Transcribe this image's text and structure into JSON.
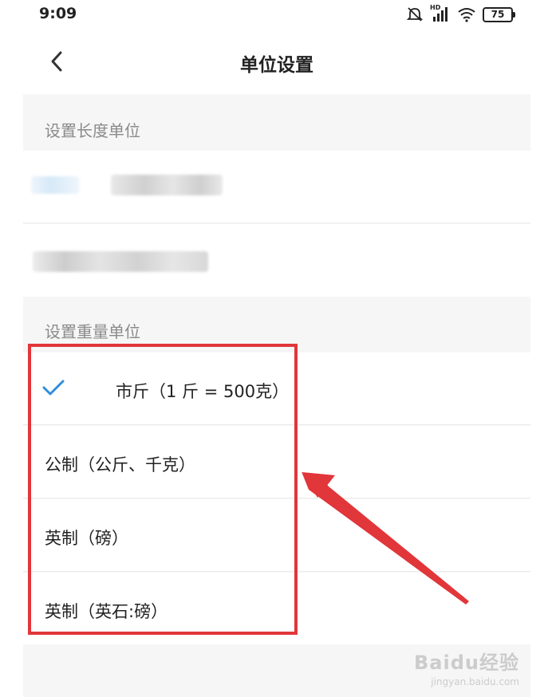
{
  "status_bar": {
    "time": "9:09",
    "network_label": "HD",
    "battery": "75"
  },
  "header": {
    "title": "单位设置"
  },
  "length_section": {
    "label": "设置长度单位"
  },
  "weight_section": {
    "label": "设置重量单位",
    "options": [
      {
        "label": "市斤（1 斤 = 500克）",
        "selected": true
      },
      {
        "label": "公制（公斤、千克）",
        "selected": false
      },
      {
        "label": "英制（磅）",
        "selected": false
      },
      {
        "label": "英制（英石:磅）",
        "selected": false
      }
    ]
  },
  "annotation": {
    "color": "#e1363a"
  },
  "watermark": {
    "main": "Baidu经验",
    "sub": "jingyan.baidu.com"
  },
  "colors": {
    "accent": "#2f8ddd",
    "background": "#f6f6f6"
  }
}
